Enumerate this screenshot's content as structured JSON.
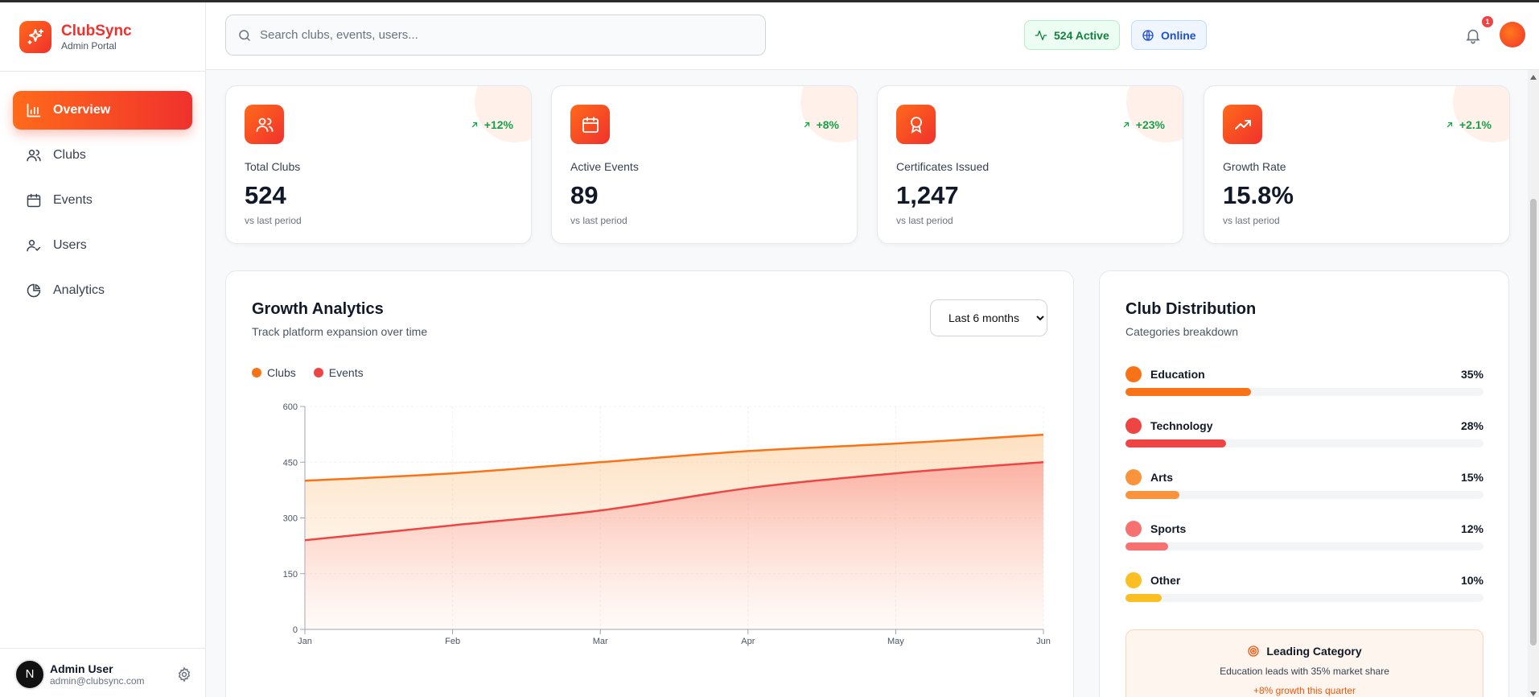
{
  "brand": {
    "name": "ClubSync",
    "subtitle": "Admin Portal"
  },
  "nav": [
    {
      "label": "Overview",
      "icon": "bar-chart-icon",
      "active": true
    },
    {
      "label": "Clubs",
      "icon": "users-icon"
    },
    {
      "label": "Events",
      "icon": "calendar-icon"
    },
    {
      "label": "Users",
      "icon": "user-check-icon"
    },
    {
      "label": "Analytics",
      "icon": "pie-chart-icon"
    }
  ],
  "user": {
    "initial": "N",
    "name": "Admin User",
    "email": "admin@clubsync.com"
  },
  "search": {
    "placeholder": "Search clubs, events, users..."
  },
  "status": {
    "active": "524 Active",
    "online": "Online"
  },
  "notifications": {
    "count": "1"
  },
  "stats": [
    {
      "label": "Total Clubs",
      "value": "524",
      "trend": "+12%",
      "sub": "vs last period",
      "icon": "users-icon"
    },
    {
      "label": "Active Events",
      "value": "89",
      "trend": "+8%",
      "sub": "vs last period",
      "icon": "calendar-icon"
    },
    {
      "label": "Certificates Issued",
      "value": "1,247",
      "trend": "+23%",
      "sub": "vs last period",
      "icon": "award-icon"
    },
    {
      "label": "Growth Rate",
      "value": "15.8%",
      "trend": "+2.1%",
      "sub": "vs last period",
      "icon": "trending-up-icon"
    }
  ],
  "growth": {
    "title": "Growth Analytics",
    "subtitle": "Track platform expansion over time",
    "range": {
      "selected": "Last 6 months"
    }
  },
  "chart_data": {
    "type": "area",
    "categories": [
      "Jan",
      "Feb",
      "Mar",
      "Apr",
      "May",
      "Jun"
    ],
    "series": [
      {
        "name": "Clubs",
        "values": [
          400,
          420,
          450,
          480,
          500,
          524
        ],
        "color": "#f97316"
      },
      {
        "name": "Events",
        "values": [
          240,
          280,
          320,
          380,
          420,
          450
        ],
        "color": "#ef4444"
      }
    ],
    "ylim": [
      0,
      600
    ],
    "yticks": [
      0,
      150,
      300,
      450,
      600
    ],
    "grid": true,
    "legend": "top-left"
  },
  "distribution": {
    "title": "Club Distribution",
    "subtitle": "Categories breakdown",
    "items": [
      {
        "label": "Education",
        "percent": "35%",
        "value": 35,
        "color": "#f97316"
      },
      {
        "label": "Technology",
        "percent": "28%",
        "value": 28,
        "color": "#ef4444"
      },
      {
        "label": "Arts",
        "percent": "15%",
        "value": 15,
        "color": "#fb923c"
      },
      {
        "label": "Sports",
        "percent": "12%",
        "value": 12,
        "color": "#f87171"
      },
      {
        "label": "Other",
        "percent": "10%",
        "value": 10,
        "color": "#fbbf24"
      }
    ],
    "leading": {
      "title": "Leading Category",
      "text": "Education leads with 35% market share",
      "growth": "+8% growth this quarter"
    }
  }
}
